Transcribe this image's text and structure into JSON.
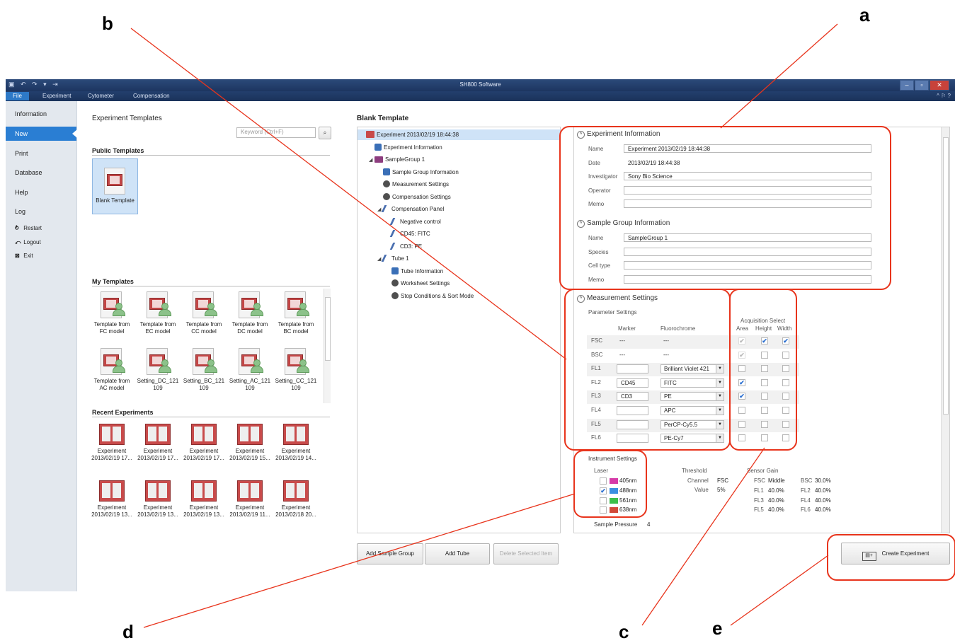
{
  "callouts": [
    "a",
    "b",
    "c",
    "d",
    "e"
  ],
  "titlebar": {
    "title": "SH800 Software"
  },
  "tabs": [
    "File",
    "Experiment",
    "Cytometer",
    "Compensation"
  ],
  "nav": {
    "items": [
      "Information",
      "New",
      "Print",
      "Database",
      "Help",
      "Log"
    ],
    "sub": [
      {
        "icon": "restart-icon",
        "glyph": "⥁",
        "label": "Restart"
      },
      {
        "icon": "logout-icon",
        "glyph": "⤺",
        "label": "Logout"
      },
      {
        "icon": "exit-icon",
        "glyph": "⊠",
        "label": "Exit"
      }
    ]
  },
  "templates": {
    "heading": "Experiment Templates",
    "search_placeholder": "Keyword (Ctrl+F)",
    "public_heading": "Public Templates",
    "public": [
      "Blank Template"
    ],
    "my_heading": "My Templates",
    "my": [
      [
        "Template from",
        "FC model"
      ],
      [
        "Template from",
        "EC model"
      ],
      [
        "Template from",
        "CC model"
      ],
      [
        "Template from",
        "DC model"
      ],
      [
        "Template from",
        "BC model"
      ],
      [
        "Template from",
        "AC model"
      ],
      [
        "Setting_DC_121",
        "109"
      ],
      [
        "Setting_BC_121",
        "109"
      ],
      [
        "Setting_AC_121",
        "109"
      ],
      [
        "Setting_CC_121",
        "109"
      ]
    ],
    "recent_heading": "Recent Experiments",
    "recent": [
      [
        "Experiment",
        "2013/02/19 17..."
      ],
      [
        "Experiment",
        "2013/02/19 17..."
      ],
      [
        "Experiment",
        "2013/02/19 17..."
      ],
      [
        "Experiment",
        "2013/02/19 15..."
      ],
      [
        "Experiment",
        "2013/02/19 14..."
      ],
      [
        "Experiment",
        "2013/02/19 13..."
      ],
      [
        "Experiment",
        "2013/02/19 13..."
      ],
      [
        "Experiment",
        "2013/02/19 13..."
      ],
      [
        "Experiment",
        "2013/02/19 11..."
      ],
      [
        "Experiment",
        "2013/02/18 20..."
      ]
    ]
  },
  "tree": {
    "heading": "Blank Template",
    "nodes": [
      {
        "label": "Experiment 2013/02/19 18:44:38",
        "level": 0,
        "icon": "exp",
        "selected": true,
        "arrow": ""
      },
      {
        "label": "Experiment Information",
        "level": 1,
        "icon": "info",
        "arrow": ""
      },
      {
        "label": "SampleGroup 1",
        "level": 1,
        "icon": "folder",
        "arrow": "◢"
      },
      {
        "label": "Sample Group Information",
        "level": 2,
        "icon": "info",
        "arrow": ""
      },
      {
        "label": "Measurement Settings",
        "level": 2,
        "icon": "gear",
        "arrow": ""
      },
      {
        "label": "Compensation Settings",
        "level": 2,
        "icon": "gear",
        "arrow": ""
      },
      {
        "label": "Compensation Panel",
        "level": 2,
        "icon": "tube",
        "arrow": "◢"
      },
      {
        "label": "Negative control",
        "level": 3,
        "icon": "tube",
        "arrow": ""
      },
      {
        "label": "CD45: FITC",
        "level": 3,
        "icon": "tube",
        "arrow": ""
      },
      {
        "label": "CD3: PE",
        "level": 3,
        "icon": "tube",
        "arrow": ""
      },
      {
        "label": "Tube 1",
        "level": 2,
        "icon": "tube",
        "arrow": "◢"
      },
      {
        "label": "Tube Information",
        "level": 3,
        "icon": "info",
        "arrow": ""
      },
      {
        "label": "Worksheet Settings",
        "level": 3,
        "icon": "gear",
        "arrow": ""
      },
      {
        "label": "Stop Conditions & Sort Mode",
        "level": 3,
        "icon": "gear",
        "arrow": ""
      }
    ],
    "buttons": [
      "Add Sample Group",
      "Add Tube",
      "Delete Selected Item"
    ]
  },
  "experiment_info": {
    "heading": "Experiment Information",
    "fields": [
      {
        "label": "Name",
        "value": "Experiment 2013/02/19 18:44:38",
        "input": true
      },
      {
        "label": "Date",
        "value": "2013/02/19 18:44:38",
        "input": false
      },
      {
        "label": "Investigator",
        "value": "Sony Bio Science",
        "input": true
      },
      {
        "label": "Operator",
        "value": "",
        "input": true
      },
      {
        "label": "Memo",
        "value": "",
        "input": true
      }
    ]
  },
  "sample_group_info": {
    "heading": "Sample Group Information",
    "fields": [
      {
        "label": "Name",
        "value": "SampleGroup 1"
      },
      {
        "label": "Species",
        "value": ""
      },
      {
        "label": "Cell type",
        "value": ""
      },
      {
        "label": "Memo",
        "value": ""
      }
    ]
  },
  "measurement": {
    "heading": "Measurement Settings",
    "param_heading": "Parameter Settings",
    "col_marker": "Marker",
    "col_fluoro": "Fluorochrome",
    "acq_heading": "Acquisition Select",
    "acq_cols": [
      "Area",
      "Height",
      "Width"
    ],
    "rows": [
      {
        "ch": "FSC",
        "marker": "---",
        "fluoro": "---",
        "editable": false,
        "area": "dim",
        "height": true,
        "width": true
      },
      {
        "ch": "BSC",
        "marker": "---",
        "fluoro": "---",
        "editable": false,
        "area": "dim",
        "height": false,
        "width": false
      },
      {
        "ch": "FL1",
        "marker": "",
        "fluoro": "Brilliant Violet 421",
        "editable": true,
        "area": false,
        "height": false,
        "width": false
      },
      {
        "ch": "FL2",
        "marker": "CD45",
        "fluoro": "FITC",
        "editable": true,
        "area": true,
        "height": false,
        "width": false
      },
      {
        "ch": "FL3",
        "marker": "CD3",
        "fluoro": "PE",
        "editable": true,
        "area": true,
        "height": false,
        "width": false
      },
      {
        "ch": "FL4",
        "marker": "",
        "fluoro": "APC",
        "editable": true,
        "area": false,
        "height": false,
        "width": false
      },
      {
        "ch": "FL5",
        "marker": "",
        "fluoro": "PerCP-Cy5.5",
        "editable": true,
        "area": false,
        "height": false,
        "width": false
      },
      {
        "ch": "FL6",
        "marker": "",
        "fluoro": "PE-Cy7",
        "editable": true,
        "area": false,
        "height": false,
        "width": false
      }
    ]
  },
  "instrument": {
    "heading": "Instrument Settings",
    "laser_heading": "Laser",
    "lasers": [
      {
        "label": "405nm",
        "checked": false,
        "color": "#d63aa8"
      },
      {
        "label": "488nm",
        "checked": true,
        "color": "#3a8fe0"
      },
      {
        "label": "561nm",
        "checked": false,
        "color": "#3cbf4a"
      },
      {
        "label": "638nm",
        "checked": false,
        "color": "#d24a3a"
      }
    ],
    "threshold_heading": "Threshold",
    "threshold": [
      [
        "Channel",
        "FSC"
      ],
      [
        "Value",
        "5%"
      ]
    ],
    "gain_heading": "Sensor Gain",
    "gain": [
      [
        "FSC",
        "Middle",
        "BSC",
        "30.0%"
      ],
      [
        "FL1",
        "40.0%",
        "FL2",
        "40.0%"
      ],
      [
        "FL3",
        "40.0%",
        "FL4",
        "40.0%"
      ],
      [
        "FL5",
        "40.0%",
        "FL6",
        "40.0%"
      ]
    ],
    "sample_pressure_label": "Sample Pressure",
    "sample_pressure_value": "4"
  },
  "create_button": "Create Experiment",
  "colors": {
    "accent": "#2a7ed3",
    "callout": "#e8341c",
    "titlebar": "#1d3560"
  }
}
